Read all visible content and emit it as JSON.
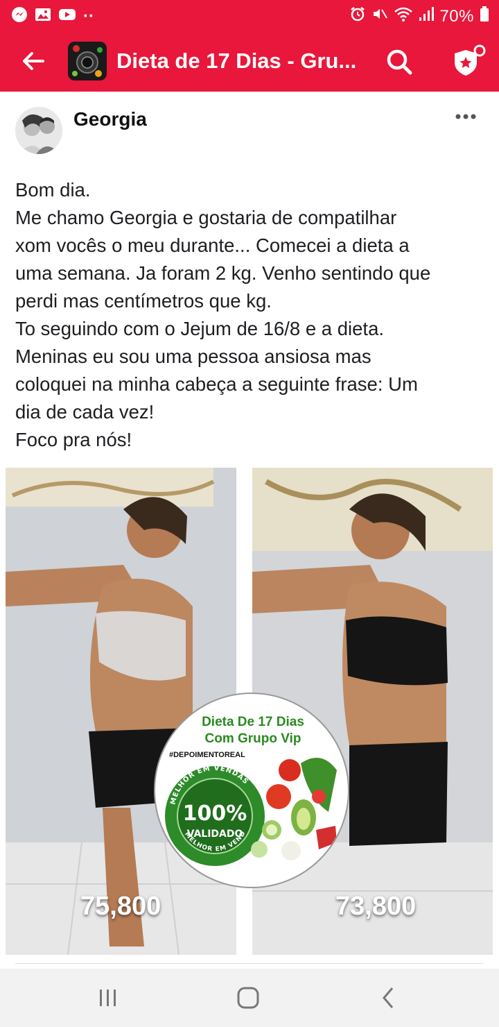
{
  "status_bar": {
    "left_icons": [
      "messenger-icon",
      "gallery-icon",
      "youtube-icon"
    ],
    "more_dots": "··",
    "battery_text": "70%",
    "colors": {
      "bar": "#e8173b",
      "fg": "#ffffff"
    }
  },
  "app_bar": {
    "title": "Dieta de 17 Dias - Gru...",
    "back_icon": "arrow-left-icon",
    "search_icon": "search-icon",
    "shield_icon": "admin-shield-icon",
    "accent": "#e8173b"
  },
  "post": {
    "author": "Georgia",
    "more_icon": "more-dots-icon",
    "text_lines": [
      "Bom dia.",
      "Me chamo Georgia e gostaria de compatilhar",
      "xom vocês o meu durante... Comecei a dieta a",
      "uma semana. Ja foram 2 kg. Venho sentindo que",
      "perdi mas centímetros que kg.",
      "To seguindo com o Jejum de 16/8 e a dieta.",
      "Meninas eu sou uma pessoa ansiosa mas",
      "coloquei na minha cabeça a seguinte frase: Um",
      "dia de cada vez!",
      "Foco pra nós!"
    ],
    "photo": {
      "before_weight": "75,800",
      "after_weight": "73,800",
      "badge": {
        "title_line1": "Dieta De 17 Dias",
        "title_line2": "Com Grupo Vip",
        "hashtag": "#DEPOIMENTOREAL",
        "seal_top": "MELHOR EM VENDAS",
        "seal_percent": "100%",
        "seal_word": "VALIDADO",
        "seal_bottom": "MELHOR EM VENDAS"
      }
    }
  },
  "nav_bar": {
    "recents_icon": "recents-icon",
    "home_icon": "home-icon",
    "back_icon": "back-chevron-icon"
  }
}
